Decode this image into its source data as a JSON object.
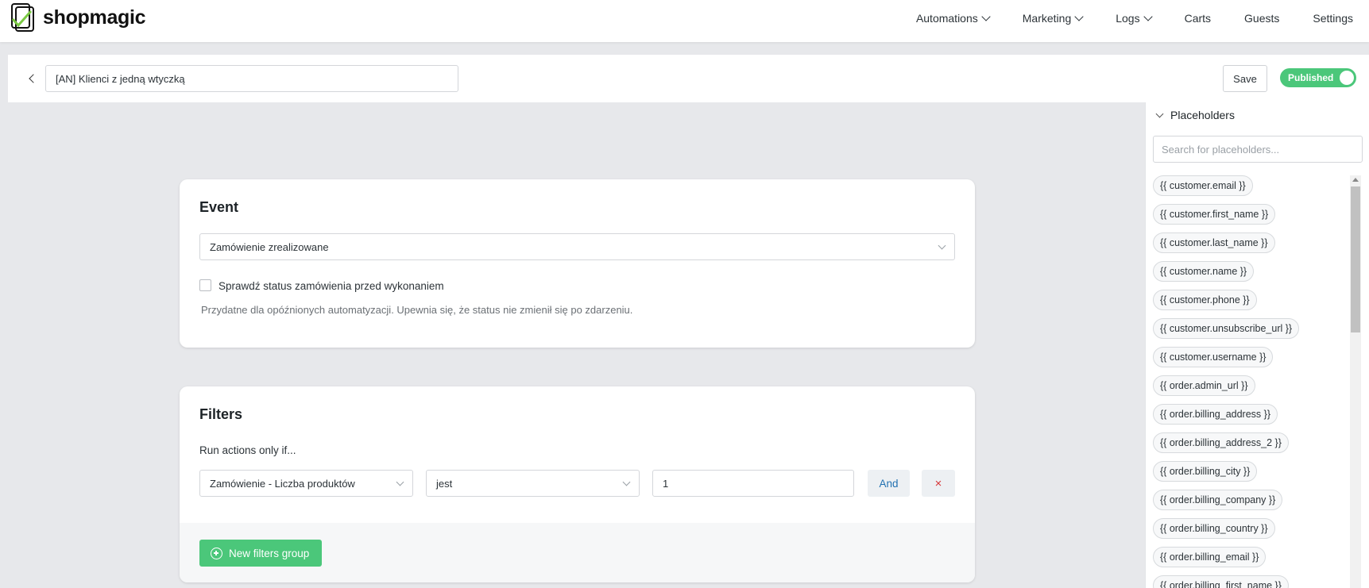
{
  "app": {
    "name": "shopmagic"
  },
  "nav": {
    "items": [
      {
        "label": "Automations",
        "dropdown": true
      },
      {
        "label": "Marketing",
        "dropdown": true
      },
      {
        "label": "Logs",
        "dropdown": true
      },
      {
        "label": "Carts",
        "dropdown": false
      },
      {
        "label": "Guests",
        "dropdown": false
      },
      {
        "label": "Settings",
        "dropdown": false
      }
    ]
  },
  "header": {
    "title_value": "[AN] Klienci z jedną wtyczką",
    "save_label": "Save",
    "status_label": "Published",
    "status_on": true
  },
  "event": {
    "title": "Event",
    "selected": "Zamówienie zrealizowane",
    "checkbox_label": "Sprawdź status zamówienia przed wykonaniem",
    "checkbox_checked": false,
    "hint": "Przydatne dla opóźnionych automatyzacji. Upewnia się, że status nie zmienił się po zdarzeniu."
  },
  "filters": {
    "title": "Filters",
    "run_label": "Run actions only if...",
    "row": {
      "field": "Zamówienie - Liczba produktów",
      "operator": "jest",
      "value": "1",
      "and_label": "And",
      "remove_label": "×"
    },
    "new_group_label": "New filters group"
  },
  "placeholders": {
    "title": "Placeholders",
    "search_placeholder": "Search for placeholders...",
    "items": [
      "{{ customer.email }}",
      "{{ customer.first_name }}",
      "{{ customer.last_name }}",
      "{{ customer.name }}",
      "{{ customer.phone }}",
      "{{ customer.unsubscribe_url }}",
      "{{ customer.username }}",
      "{{ order.admin_url }}",
      "{{ order.billing_address }}",
      "{{ order.billing_address_2 }}",
      "{{ order.billing_city }}",
      "{{ order.billing_company }}",
      "{{ order.billing_country }}",
      "{{ order.billing_email }}",
      "{{ order.billing_first_name }}"
    ]
  },
  "colors": {
    "accent_green": "#4bc77a",
    "link_blue": "#2271b1",
    "danger_red": "#d63638"
  }
}
